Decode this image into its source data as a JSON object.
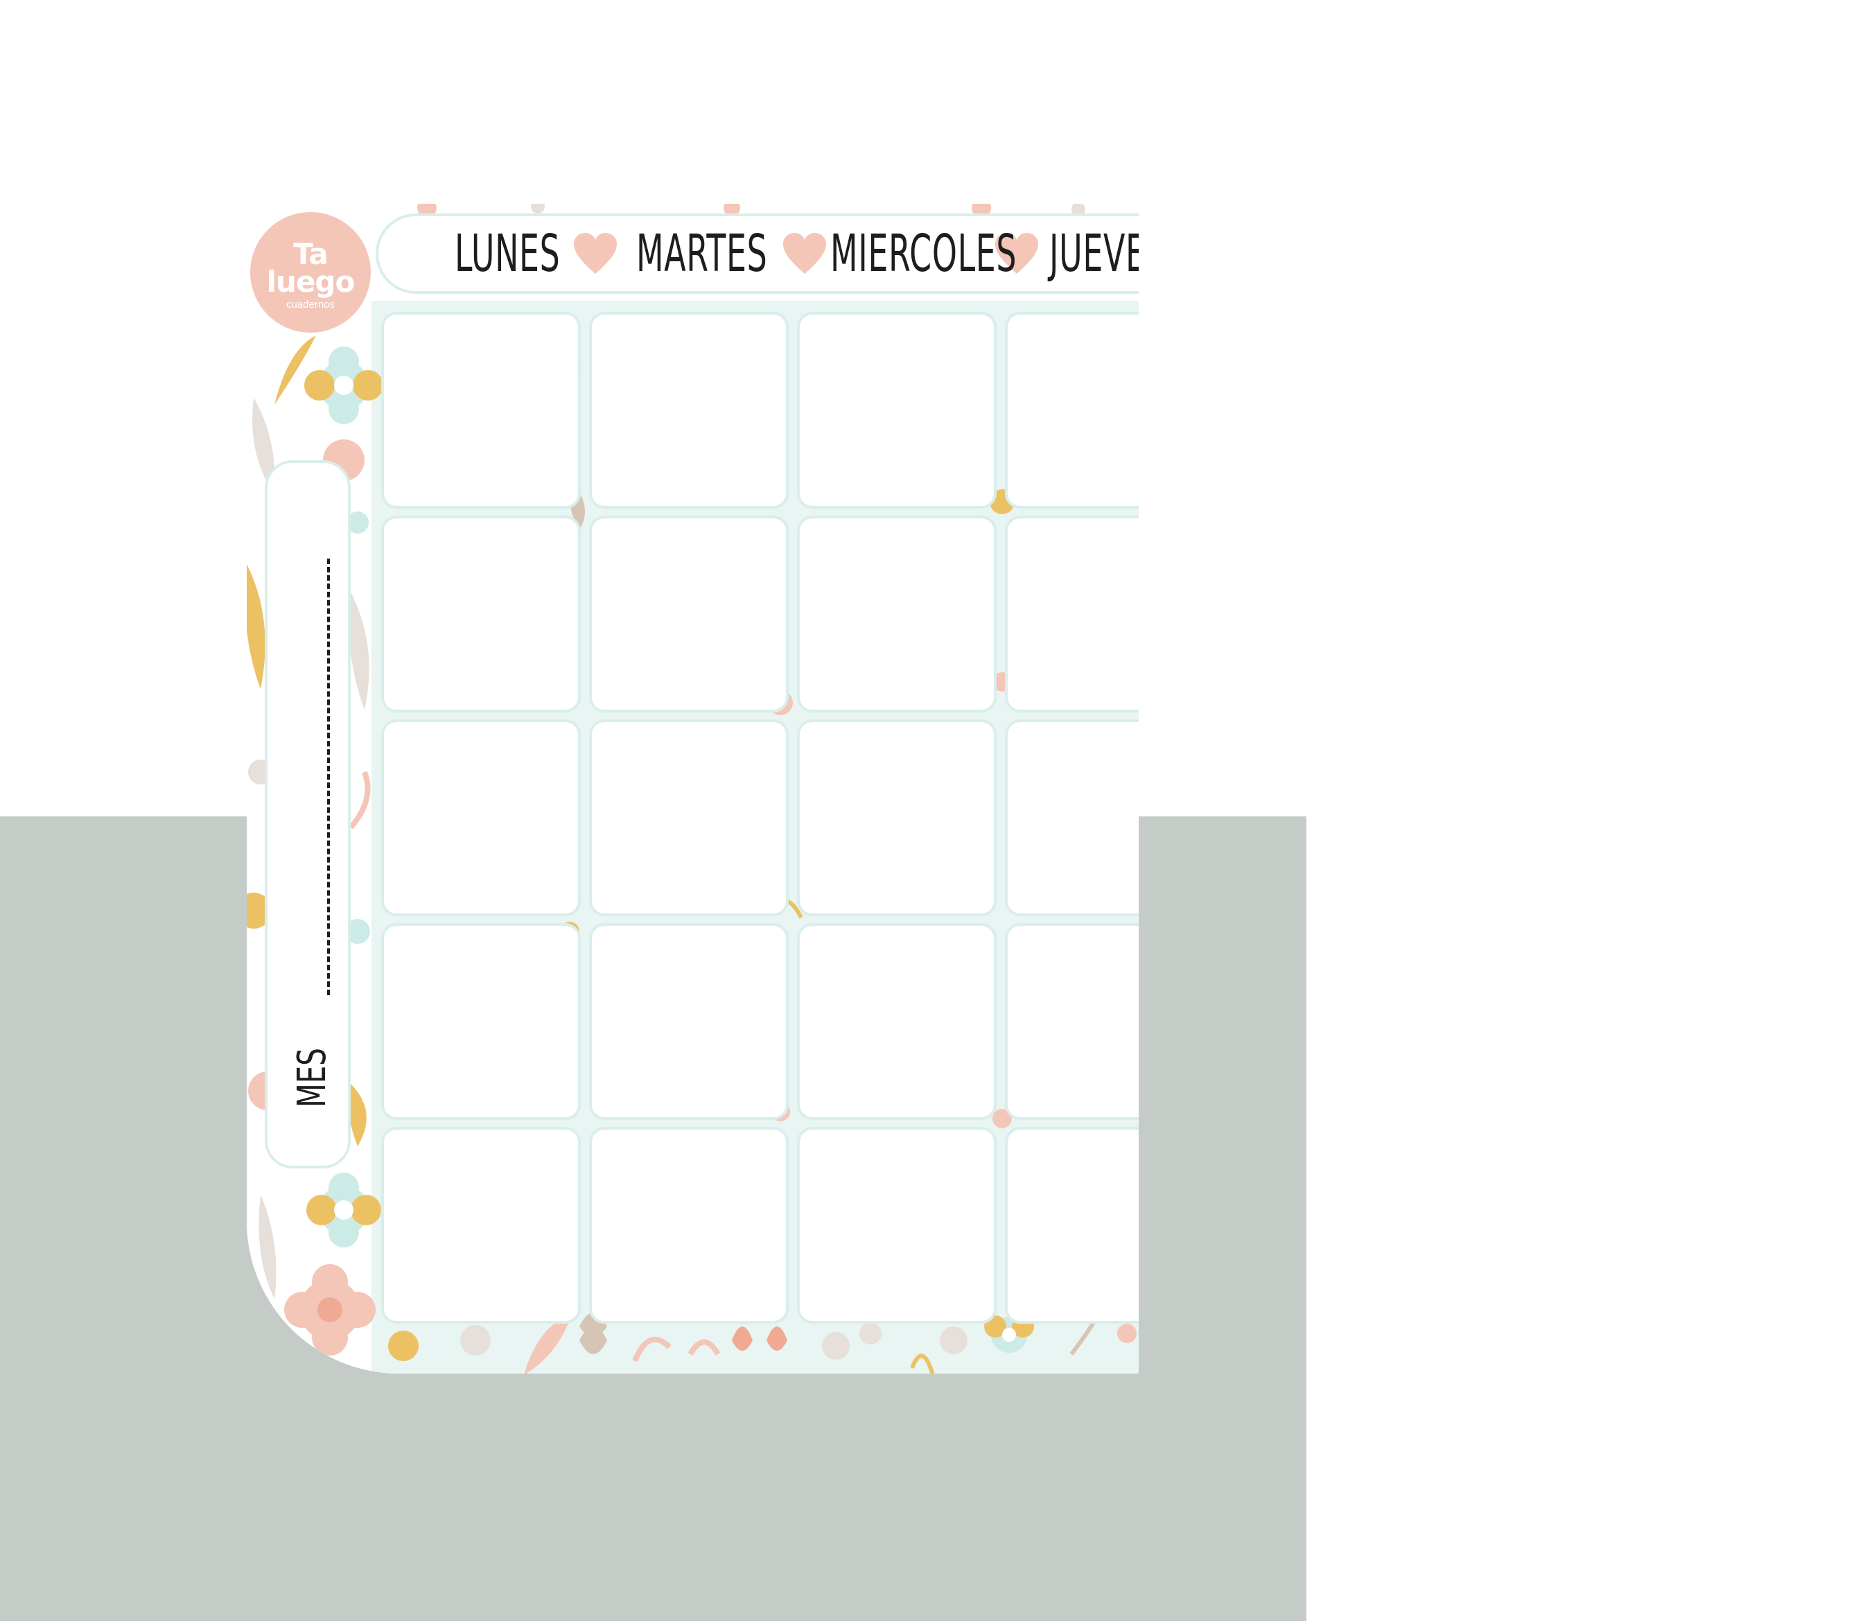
{
  "planner": {
    "logo": {
      "line1": "Ta",
      "line2": "luego",
      "subtitle": "cuadernos"
    },
    "days": [
      "LUNES",
      "MARTES",
      "MIERCOLES",
      "JUEVES"
    ],
    "month_label": "MES",
    "grid": {
      "rows": 5,
      "columns_visible": 4
    }
  },
  "colors": {
    "backdrop": "#c5ccc8",
    "cell_border": "#d9eeea",
    "pink": "#f4c6b8",
    "yellow": "#ecc163",
    "mint": "#cdebe6",
    "taupe": "#d6c4b5",
    "text": "#1d1d1d"
  }
}
